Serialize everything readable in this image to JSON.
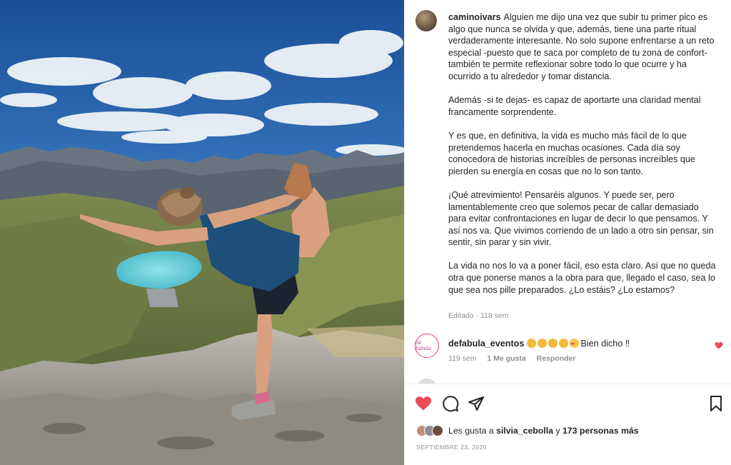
{
  "post": {
    "username": "caminoivars",
    "caption_paragraphs": [
      "Alguien me dijo una vez que subir tu primer pico es algo que nunca se olvida y que, además, tiene una parte ritual verdaderamente interesante. No solo supone enfrentarse a un reto especial -puesto que te saca por completo de tu zona de confort- también te permite reflexionar sobre todo lo que ocurre y ha ocurrido a tu alrededor y tomar distancia.",
      "Además -si te dejas- es capaz de aportarte una claridad mental francamente sorprendente.",
      "Y es que, en definitiva, la vida es mucho más fácil de lo que pretendemos hacerla en muchas ocasiones. Cada día soy conocedora de historias increíbles de personas increíbles que pierden su energía en cosas que no lo son tanto.",
      "¡Qué atrevimiento! Pensaréis algunos. Y puede ser, pero lamentablemente creo que solemos pecar de callar demasiado para evitar confrontaciones en lugar de decir lo que pensamos. Y así nos va. Que vivimos corriendo de un lado a otro sin pensar, sin sentir, sin parar y sin vivir.",
      "La vida no nos lo va a poner fácil, eso esta claro. Así que no queda otra que ponerse manos a la obra para que, llegado el caso, sea lo que sea nos pille preparados. ¿Lo estáis? ¿Lo estamos?"
    ],
    "caption_meta": "Editado · 118 sem",
    "likes_prefix": "Les gusta a ",
    "likes_user": "silvia_cebolla",
    "likes_middle": " y ",
    "likes_count": "173 personas más",
    "date": "SEPTIEMBRE 23, 2020"
  },
  "comment": {
    "username": "defabula_eventos",
    "avatar_text": "de fabula",
    "text": "Bien dicho ‼",
    "time": "119 sem",
    "likes": "1 Me gusta",
    "reply": "Responder"
  },
  "icons": {
    "like": "heart-filled-icon",
    "comment": "comment-bubble-icon",
    "share": "paper-plane-icon",
    "save": "bookmark-icon",
    "comment_like": "heart-small-icon"
  },
  "colors": {
    "like_red": "#ed4956",
    "muted": "#8e8e8e",
    "text": "#262626"
  }
}
